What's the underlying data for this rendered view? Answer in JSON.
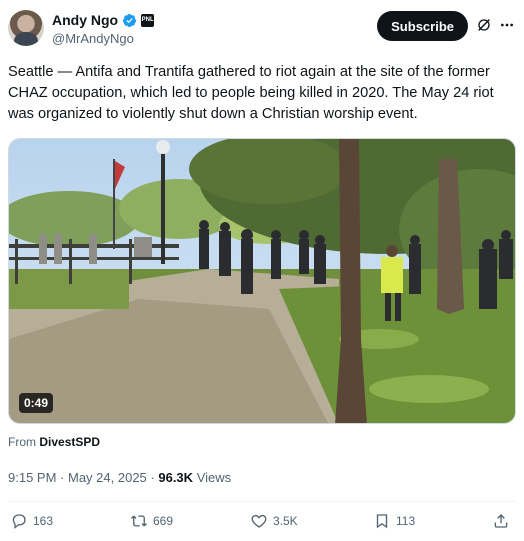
{
  "author": {
    "display_name": "Andy Ngo",
    "handle": "@MrAndyNgo",
    "badge": "PNL",
    "verified_color": "#1d9bf0"
  },
  "subscribe_label": "Subscribe",
  "icons": [
    "grok-icon",
    "more-icon",
    "reply-icon",
    "repost-icon",
    "like-icon",
    "bookmark-icon",
    "share-icon"
  ],
  "tweet": {
    "text": "Seattle — Antifa and Trantifa gathered to riot again at the site of the former CHAZ occupation, which led to people being killed in 2020. The May 24 riot was organized to violently shut down a Christian worship event."
  },
  "media": {
    "duration": "0:49"
  },
  "source": {
    "prefix": "From",
    "name": "DivestSPD"
  },
  "meta": {
    "time": "9:15 PM",
    "date": "May 24, 2025",
    "views_count": "96.3K",
    "views_label": "Views"
  },
  "actions": {
    "replies": "163",
    "reposts": "669",
    "likes": "3.5K",
    "bookmarks": "113"
  }
}
